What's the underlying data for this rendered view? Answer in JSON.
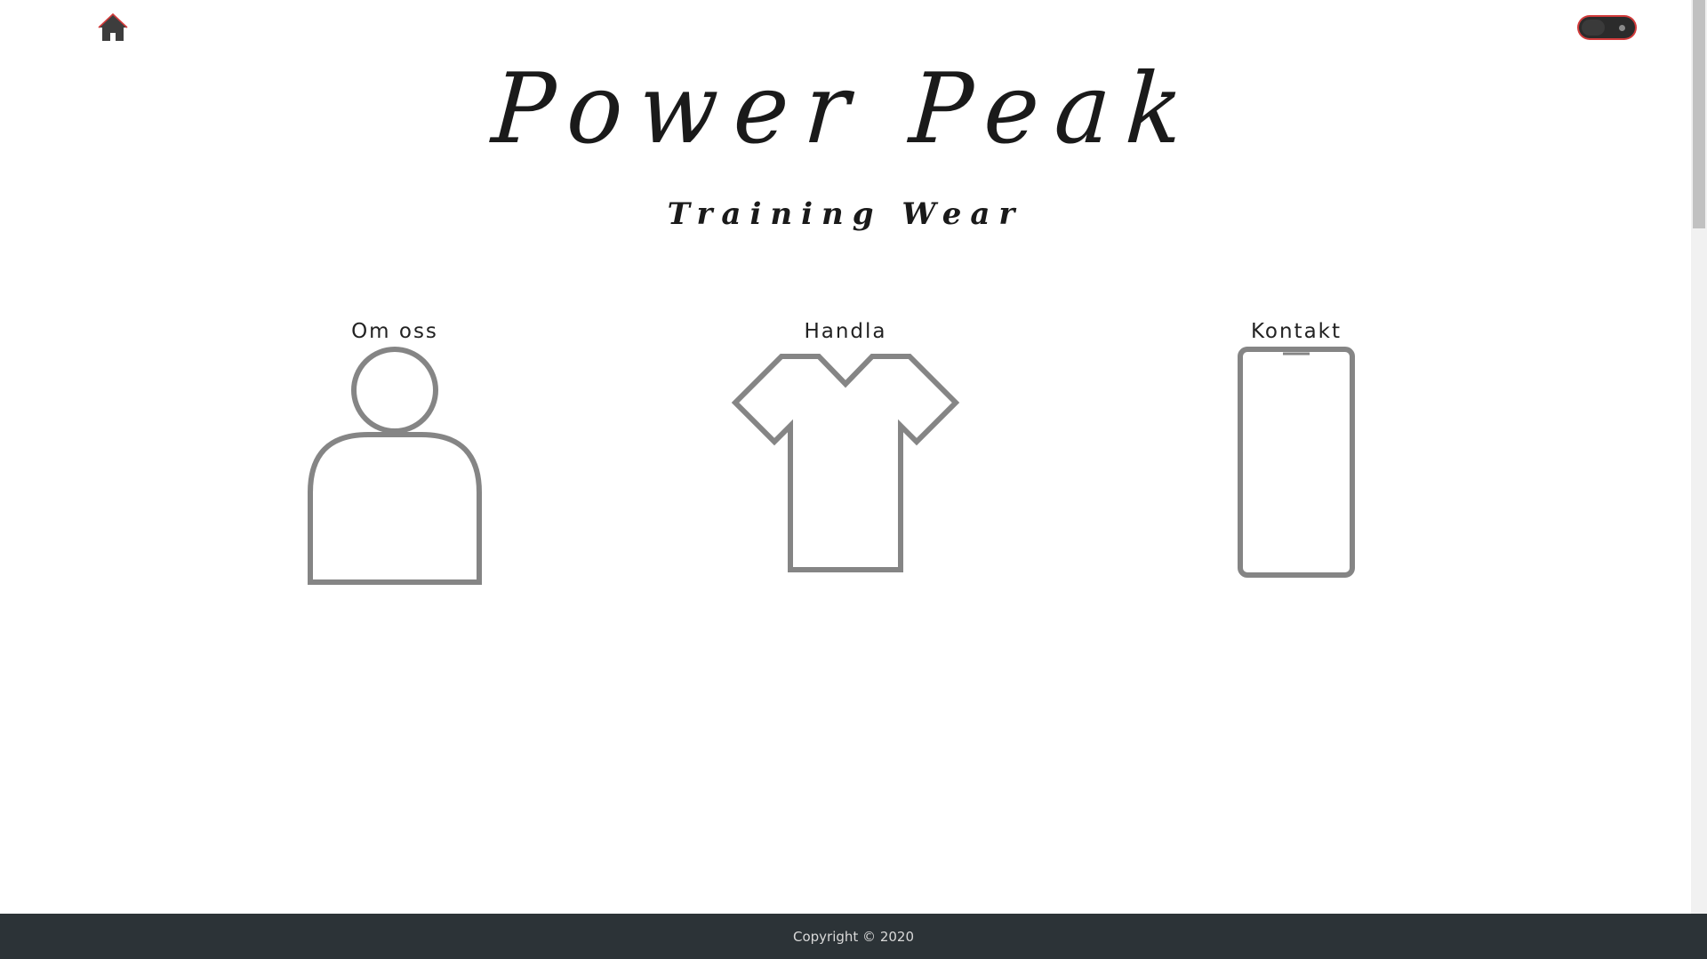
{
  "header": {
    "home_icon": "home-icon",
    "theme_toggle": {
      "icon": "theme-toggle",
      "accent": "#d23b3b",
      "state": "dark"
    }
  },
  "brand": {
    "title": "Power Peak",
    "subtitle": "Training Wear"
  },
  "nav": [
    {
      "label": "Om oss",
      "icon": "person-icon"
    },
    {
      "label": "Handla",
      "icon": "tshirt-icon"
    },
    {
      "label": "Kontakt",
      "icon": "phone-icon"
    }
  ],
  "footer": {
    "copyright": "Copyright © 2020"
  },
  "colors": {
    "icon_stroke": "#858585",
    "footer_bg": "#2c3337",
    "text": "#1a1a1a",
    "accent": "#d23b3b"
  }
}
